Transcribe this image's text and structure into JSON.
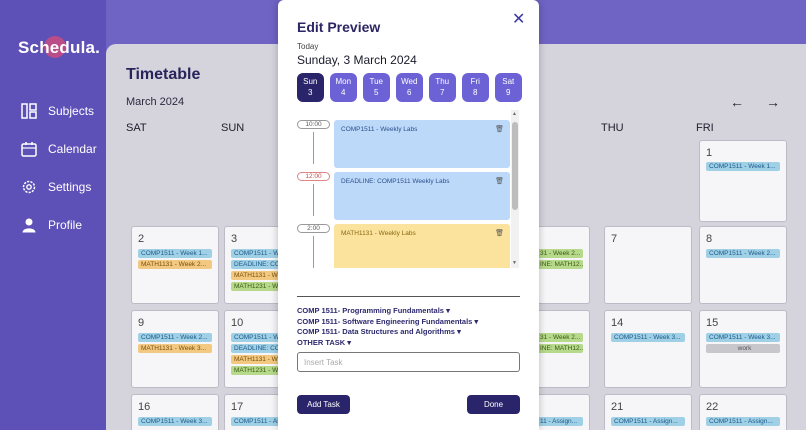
{
  "app": {
    "name": "Schedula."
  },
  "sidebar": {
    "items": [
      {
        "label": "Subjects",
        "icon": "subjects-icon"
      },
      {
        "label": "Calendar",
        "icon": "calendar-icon"
      },
      {
        "label": "Settings",
        "icon": "gear-icon"
      },
      {
        "label": "Profile",
        "icon": "user-icon"
      }
    ]
  },
  "timetable": {
    "title": "Timetable",
    "month": "March 2024",
    "days": [
      "SAT",
      "SUN",
      "THU",
      "FRI"
    ],
    "cells": [
      {
        "num": "1",
        "chips": [
          "COMP1511 - Week 1..."
        ]
      },
      {
        "num": "2",
        "chips": [
          "COMP1511 - Week 1...",
          "MATH1131 - Week 2..."
        ]
      },
      {
        "num": "3",
        "chips": [
          "COMP1511 - We",
          "DEADLINE: CO",
          "MATH1131 - We",
          "MATH1231 - We"
        ]
      },
      {
        "num": "7",
        "chips": []
      },
      {
        "num": "8",
        "chips": [
          "COMP1511 - Week 2..."
        ]
      },
      {
        "num": "9",
        "chips": [
          "COMP1511 - Week 2...",
          "MATH1131 - Week 3..."
        ]
      },
      {
        "num": "10",
        "chips": [
          "COMP1511 - We",
          "DEADLINE: CO",
          "MATH1131 - We",
          "MATH1231 - We"
        ]
      },
      {
        "num": "14",
        "chips": [
          "COMP1511 - Week 3..."
        ]
      },
      {
        "num": "15",
        "chips": [
          "COMP1511 - Week 3...",
          "work"
        ]
      },
      {
        "num": "16",
        "chips": [
          "COMP1511 - Week 3..."
        ]
      },
      {
        "num": "17",
        "chips": [
          "COMP1511 - As"
        ]
      },
      {
        "num": "21",
        "chips": [
          "COMP1511 - Assign..."
        ]
      },
      {
        "num": "22",
        "chips": [
          "COMP1511 - Assign..."
        ]
      }
    ],
    "peek": [
      "31 - Week 2...",
      "INE: MATH12...",
      "31 - Week 2...",
      "INE: MATH12...",
      "11 - Assign..."
    ]
  },
  "modal": {
    "title": "Edit Preview",
    "today_label": "Today",
    "date": "Sunday, 3 March 2024",
    "days": [
      {
        "name": "Sun",
        "num": "3"
      },
      {
        "name": "Mon",
        "num": "4"
      },
      {
        "name": "Tue",
        "num": "5"
      },
      {
        "name": "Wed",
        "num": "6"
      },
      {
        "name": "Thu",
        "num": "7"
      },
      {
        "name": "Fri",
        "num": "8"
      },
      {
        "name": "Sat",
        "num": "9"
      }
    ],
    "times": [
      "10:00",
      "12:00",
      "2:00"
    ],
    "events": [
      {
        "label": "COMP1511 - Weekly Labs"
      },
      {
        "label": "DEADLINE: COMP1511 Weekly Labs"
      },
      {
        "label": "MATH1131 - Weekly Labs"
      }
    ],
    "courses": [
      "COMP 1511- Programming Fundamentals",
      "COMP 1511- Software Engineering Fundamentals",
      "COMP 1511- Data Structures and Algorithms",
      "OTHER TASK"
    ],
    "insert_placeholder": "Insert Task",
    "add_label": "Add Task",
    "done_label": "Done"
  },
  "colors": {
    "accent": "#2a256a",
    "primary": "#6c62d6",
    "sidebar": "#5d50b6"
  }
}
